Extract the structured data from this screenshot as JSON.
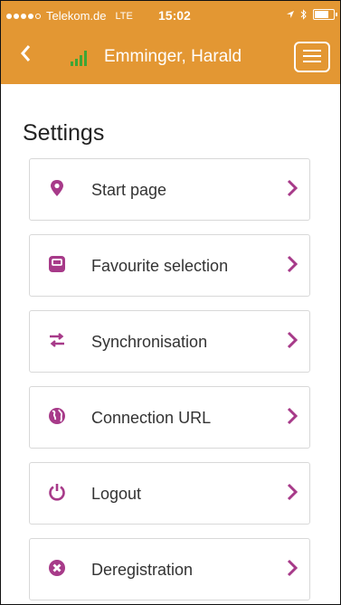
{
  "status_bar": {
    "carrier": "Telekom.de",
    "network": "LTE",
    "time": "15:02",
    "signal_bars": 4,
    "battery_level": 0.8
  },
  "header": {
    "back_icon": "chevron-left-icon",
    "signal_icon": "signal-bars-icon",
    "user_name": "Emminger, Harald",
    "menu_icon": "hamburger-menu-icon"
  },
  "page": {
    "title": "Settings"
  },
  "settings": {
    "items": [
      {
        "label": "Start page",
        "icon": "map-marker-icon"
      },
      {
        "label": "Favourite selection",
        "icon": "square-icon"
      },
      {
        "label": "Synchronisation",
        "icon": "exchange-arrows-icon"
      },
      {
        "label": "Connection URL",
        "icon": "globe-icon"
      },
      {
        "label": "Logout",
        "icon": "power-icon"
      },
      {
        "label": "Deregistration",
        "icon": "x-circle-icon"
      }
    ]
  },
  "colors": {
    "header_bg": "#e39733",
    "accent": "#a73a89",
    "signal_green": "#3fa535"
  }
}
